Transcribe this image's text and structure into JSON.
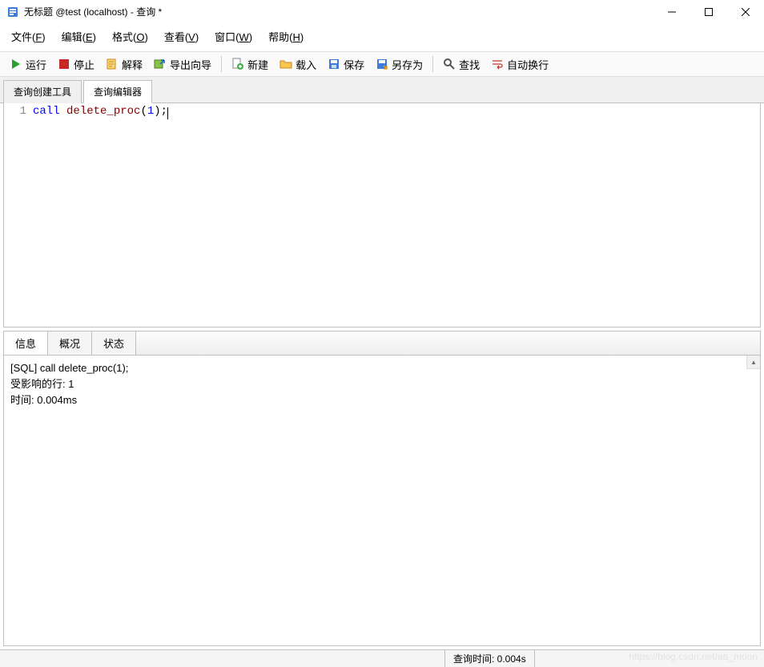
{
  "window": {
    "title": "无标题 @test (localhost) - 查询 *",
    "app_icon": "query-icon"
  },
  "menu": {
    "file": "文件(F)",
    "edit": "编辑(E)",
    "format": "格式(O)",
    "view": "查看(V)",
    "window": "窗口(W)",
    "help": "帮助(H)"
  },
  "toolbar": {
    "run": "运行",
    "stop": "停止",
    "explain": "解释",
    "export_wizard": "导出向导",
    "new": "新建",
    "load": "载入",
    "save": "保存",
    "save_as": "另存为",
    "find": "查找",
    "autowrap": "自动换行"
  },
  "tabs_upper": {
    "builder": "查询创建工具",
    "editor": "查询编辑器",
    "active": "editor"
  },
  "code": {
    "lines": [
      {
        "n": "1",
        "tokens": [
          {
            "t": "call",
            "cls": "kw"
          },
          {
            "t": " ",
            "cls": ""
          },
          {
            "t": "delete_proc",
            "cls": "id"
          },
          {
            "t": "(",
            "cls": ""
          },
          {
            "t": "1",
            "cls": "kw"
          },
          {
            "t": ");",
            "cls": ""
          }
        ]
      }
    ]
  },
  "result_tabs": {
    "info": "信息",
    "profile": "概况",
    "status": "状态",
    "active": "info"
  },
  "result_text": {
    "l1": "[SQL] call delete_proc(1);",
    "l2": "受影响的行: 1",
    "l3": "时间: 0.004ms"
  },
  "statusbar": {
    "query_time": "查询时间: 0.004s"
  },
  "watermark": "https://blog.csdn.net/aa_moon"
}
